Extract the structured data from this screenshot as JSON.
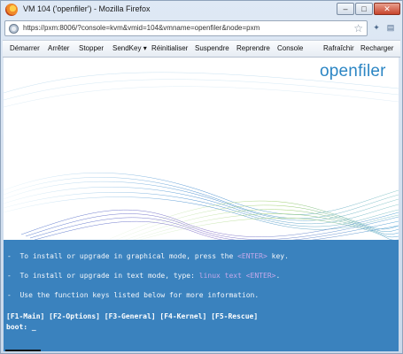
{
  "window": {
    "title": "VM 104 ('openfiler') - Mozilla Firefox"
  },
  "browser": {
    "url": "https://pxm:8006/?console=kvm&vmid=104&vmname=openfiler&node=pxm",
    "window_buttons": [
      "–",
      "□",
      "✕"
    ]
  },
  "vm_toolbar": {
    "buttons": [
      "Démarrer",
      "Arrêter",
      "Stopper",
      "SendKey",
      "Réinitialiser",
      "Suspendre",
      "Reprendre",
      "Console",
      "Rafraîchir",
      "Recharger"
    ]
  },
  "console": {
    "logo": "openfiler",
    "line1_pre": "-  To install or upgrade in graphical mode, press the ",
    "line1_key": "<ENTER>",
    "line1_post": " key.",
    "line2_pre": "-  To install or upgrade in text mode, type: ",
    "line2_key": "linux text <ENTER>",
    "line2_post": ".",
    "line3": "-  Use the function keys listed below for more information.",
    "fkeys": "[F1-Main] [F2-Options] [F3-General] [F4-Kernel] [F5-Rescue]",
    "prompt": "boot: _"
  },
  "colors": {
    "console_bg": "#3a82be",
    "key_highlight": "#c4a9ea",
    "logo": "#2c86c4"
  }
}
